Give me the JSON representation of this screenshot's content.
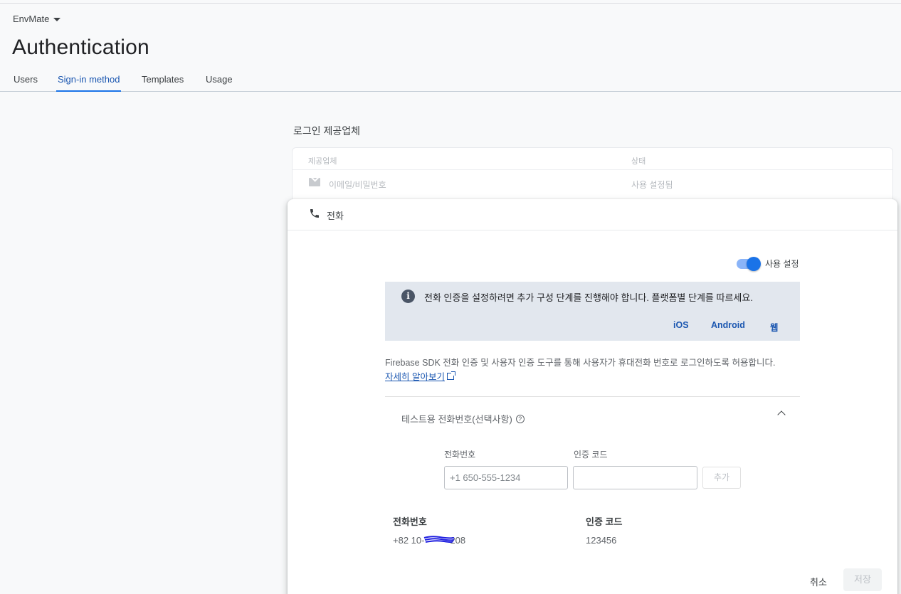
{
  "header": {
    "project_name": "EnvMate",
    "page_title": "Authentication",
    "tabs": [
      {
        "label": "Users"
      },
      {
        "label": "Sign-in method"
      },
      {
        "label": "Templates"
      },
      {
        "label": "Usage"
      }
    ],
    "active_tab": "Sign-in method"
  },
  "providers": {
    "section_title": "로그인 제공업체",
    "col_provider": "제공업체",
    "col_status": "상태",
    "rows": [
      {
        "name": "이메일/비밀번호",
        "status": "사용 설정됨",
        "icon": "mail-icon"
      }
    ]
  },
  "phone_panel": {
    "title": "전화",
    "icon": "phone-icon",
    "toggle_label": "사용 설정",
    "toggle_on": true,
    "info_text": "전화 인증을 설정하려면 추가 구성 단계를 진행해야 합니다. 플랫폼별 단계를 따르세요.",
    "platform_links": [
      "iOS",
      "Android",
      "웹"
    ],
    "description": "Firebase SDK 전화 인증 및 사용자 인증 도구를 통해 사용자가 휴대전화 번호로 로그인하도록 허용합니다.",
    "learn_more": "자세히 알아보기",
    "test_section_title": "테스트용 전화번호(선택사항)",
    "phone_label": "전화번호",
    "code_label": "인증 코드",
    "phone_placeholder": "+1 650-555-1234",
    "code_placeholder": "",
    "add_button": "추가",
    "table_header_phone": "전화번호",
    "table_header_code": "인증 코드",
    "test_numbers": [
      {
        "phone": "+82 10-",
        "phone_suffix": "208",
        "code": "123456"
      }
    ],
    "cancel_button": "취소",
    "save_button": "저장"
  },
  "colors": {
    "accent": "#1a73e8",
    "link": "#1a56b0",
    "info_bg": "#e2e7ee",
    "redaction": "#1f1fe0"
  }
}
